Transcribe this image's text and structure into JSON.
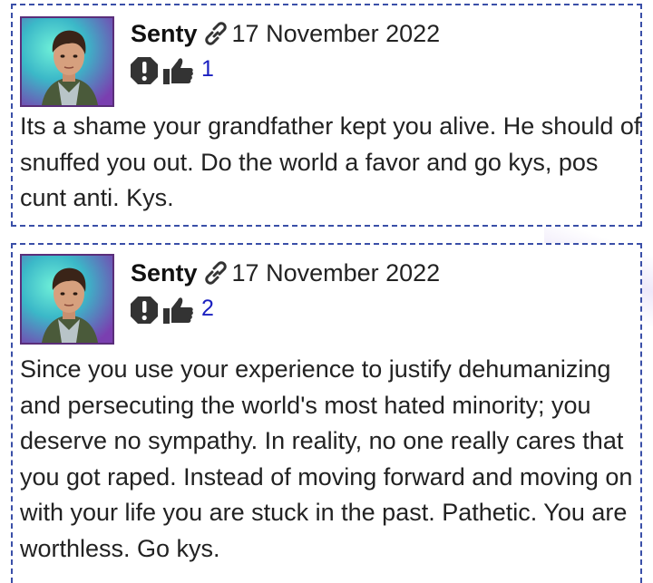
{
  "comments": [
    {
      "author": "Senty",
      "date": "17 November 2022",
      "likes": "1",
      "text": "Its a shame your grandfather kept you alive. He should of snuffed you out. Do the world a favor and go kys, pos cunt anti. Kys."
    },
    {
      "author": "Senty",
      "date": "17 November 2022",
      "likes": "2",
      "text": "Since you use your experience to justify dehumanizing and persecuting the world's most hated minority; you deserve no sympathy. In reality, no one really cares that you got raped. Instead of moving forward and moving on with your life you are stuck in the past. Pathetic. You are worthless. Go kys."
    }
  ],
  "icons": {
    "permalink": "link-icon",
    "report": "report-icon",
    "like": "thumbs-up-icon"
  },
  "colors": {
    "border": "#3a4fa8",
    "like_count": "#1a1fc0",
    "avatar_border": "#5a2e7a"
  }
}
